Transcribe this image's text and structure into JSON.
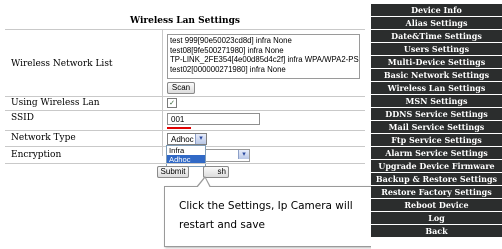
{
  "main": {
    "title": "Wireless Lan Settings",
    "labels": {
      "network_list": "Wireless Network List",
      "using_wireless": "Using Wireless Lan",
      "ssid": "SSID",
      "network_type": "Network Type",
      "encryption": "Encryption"
    },
    "networks": [
      "test 999[90e50023cd8d] infra None",
      "test08[9fe500271980] infra None",
      "TP-LINK_2FE354[4e00d85d4c2f] infra WPA/WPA2-PSK",
      "test02[000000271980] infra None"
    ],
    "scan_label": "Scan",
    "using_wireless_checked": "✓",
    "ssid_value": "001",
    "network_type_value": "Adhoc",
    "network_type_options": [
      "Infra",
      "Adhoc"
    ],
    "submit_label": "Submit",
    "refresh_partial": "sh"
  },
  "callout": {
    "line1": "Click  the  Settings,  Ip  Camera  will",
    "line2": "restart and save"
  },
  "sidebar": {
    "items": [
      "Device Info",
      "Alias Settings",
      "Date&Time Settings",
      "Users Settings",
      "Multi-Device Settings",
      "Basic Network Settings",
      "Wireless Lan Settings",
      "MSN Settings",
      "DDNS Service Settings",
      "Mail Service Settings",
      "Ftp Service Settings",
      "Alarm Service Settings",
      "Upgrade Device Firmware",
      "Backup & Restore Settings",
      "Restore Factory Settings",
      "Reboot Device",
      "Log",
      "Back"
    ]
  }
}
